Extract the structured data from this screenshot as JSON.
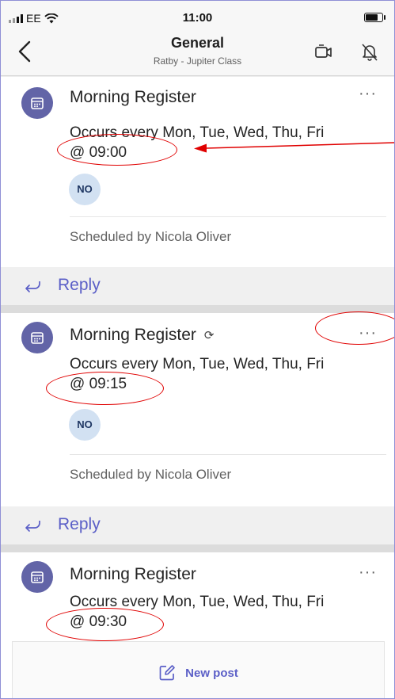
{
  "status_bar": {
    "carrier": "EE",
    "time": "11:00",
    "battery_level": 0.85
  },
  "header": {
    "title": "General",
    "subtitle": "Ratby - Jupiter Class"
  },
  "posts": [
    {
      "title": "Morning Register",
      "recurring": false,
      "occurs_line1": "Occurs every Mon, Tue, Wed, Thu, Fri",
      "occurs_line2": "@ 09:00",
      "attendee_initials": "NO",
      "scheduled_by": "Scheduled by Nicola Oliver"
    },
    {
      "title": "Morning Register",
      "recurring": true,
      "occurs_line1": "Occurs every Mon, Tue, Wed, Thu, Fri",
      "occurs_line2": "@ 09:15",
      "attendee_initials": "NO",
      "scheduled_by": "Scheduled by Nicola Oliver"
    },
    {
      "title": "Morning Register",
      "recurring": false,
      "occurs_line1": "Occurs every Mon, Tue, Wed, Thu, Fri",
      "occurs_line2": "@ 09:30"
    }
  ],
  "reply_label": "Reply",
  "more_label": "···",
  "recurring_glyph": "⟳",
  "new_post_label": "New post",
  "colors": {
    "accent": "#6264a7",
    "link": "#5b5fc7",
    "annotation": "#e00000"
  },
  "icons": [
    "back-chevron-icon",
    "video-call-icon",
    "bell-off-icon",
    "calendar-icon",
    "recurring-icon",
    "reply-arrow-icon",
    "compose-icon",
    "annotation-arrow-icon"
  ]
}
